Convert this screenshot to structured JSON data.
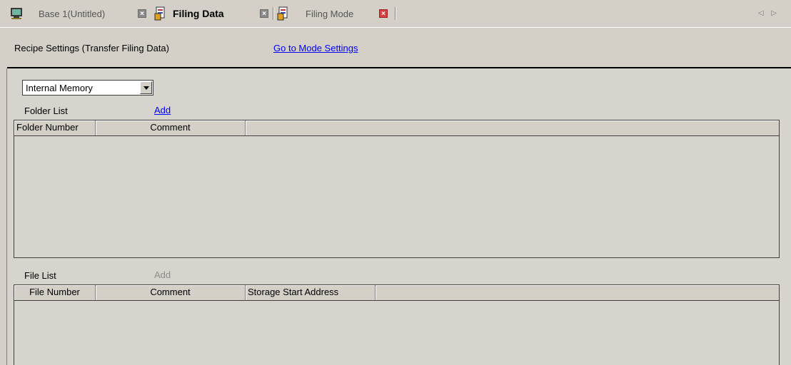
{
  "tabs": [
    {
      "label": "Base 1(Untitled)",
      "icon": "monitor-icon",
      "active": false
    },
    {
      "label": "Filing Data",
      "icon": "recipe-document-icon",
      "active": true
    },
    {
      "label": "Filing Mode",
      "icon": "recipe-document-icon",
      "active": false
    }
  ],
  "tab_close_symbol": "×",
  "tab_scroll": "◁ ▷",
  "header": {
    "title": "Recipe Settings (Transfer Filing Data)",
    "mode_link": "Go to Mode Settings"
  },
  "storage": {
    "selected": "Internal Memory"
  },
  "folder_list": {
    "label": "Folder List",
    "add_label": "Add",
    "columns": [
      "Folder Number",
      "Comment",
      ""
    ],
    "rows": []
  },
  "file_list": {
    "label": "File List",
    "add_label": "Add",
    "columns": [
      "File Number",
      "Comment",
      "Storage Start Address",
      ""
    ],
    "rows": []
  },
  "colors": {
    "panel": "#d4d0c8",
    "link": "#0000ff",
    "close_active": "#d64040"
  }
}
